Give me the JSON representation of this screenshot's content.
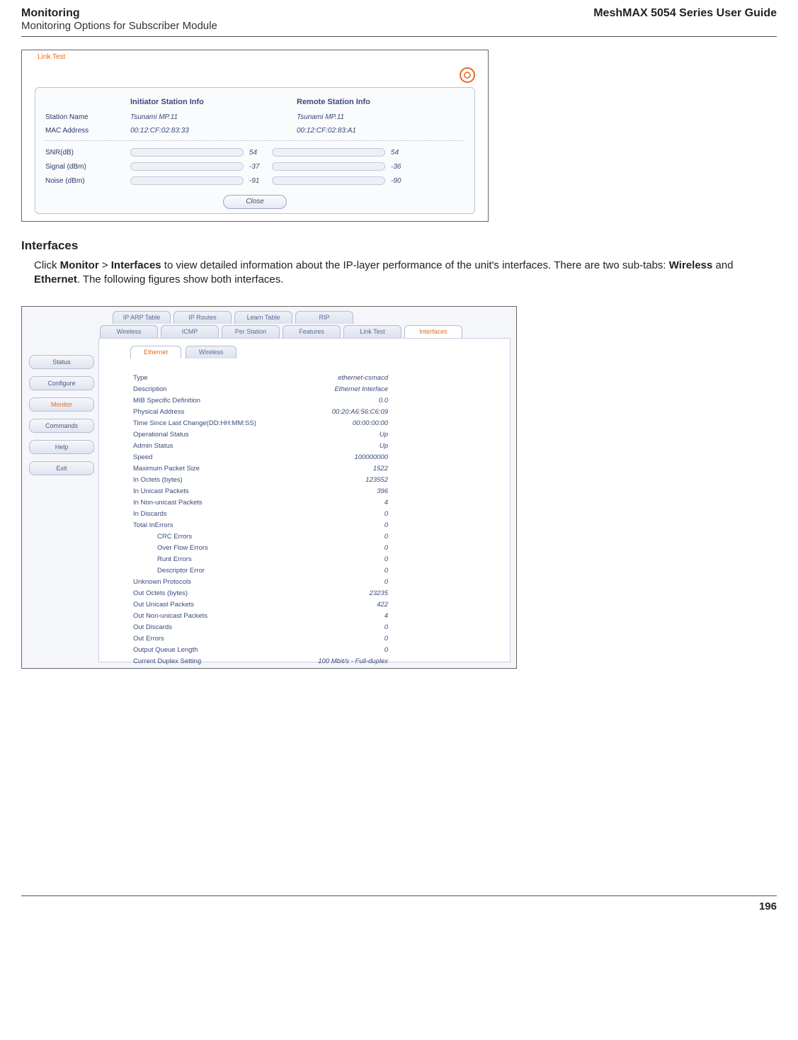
{
  "header": {
    "left_title": "Monitoring",
    "left_sub": "Monitoring Options for Subscriber Module",
    "right": "MeshMAX 5054 Series User Guide"
  },
  "fig1": {
    "title": "Link Test",
    "col_initiator": "Initiator Station Info",
    "col_remote": "Remote Station Info",
    "row_station_label": "Station Name",
    "row_station_init": "Tsunami MP.11",
    "row_station_remote": "Tsunami MP.11",
    "row_mac_label": "MAC Address",
    "row_mac_init": "00:12:CF:02:83:33",
    "row_mac_remote": "00:12:CF:02:83:A1",
    "row_snr_label": "SNR(dB)",
    "row_snr_init": "54",
    "row_snr_remote": "54",
    "row_sig_label": "Signal (dBm)",
    "row_sig_init": "-37",
    "row_sig_remote": "-36",
    "row_noise_label": "Noise (dBm)",
    "row_noise_init": "-91",
    "row_noise_remote": "-90",
    "close": "Close"
  },
  "section_h": "Interfaces",
  "body_text_pre": "Click ",
  "body_text_monitor": "Monitor",
  "body_text_gt": " > ",
  "body_text_interfaces": "Interfaces",
  "body_text_mid": " to view detailed information about the IP-layer performance of the unit's interfaces. There are two sub-tabs: ",
  "body_text_wireless": "Wireless",
  "body_text_and": " and ",
  "body_text_eth": "Ethernet",
  "body_text_end": ". The following figures show both interfaces.",
  "fig2": {
    "nav": [
      "Status",
      "Configure",
      "Monitor",
      "Commands",
      "Help",
      "Exit"
    ],
    "tabs_top": [
      "IP ARP Table",
      "IP Routes",
      "Learn Table",
      "RIP"
    ],
    "tabs_mid": [
      "Wireless",
      "ICMP",
      "Per Station",
      "Features",
      "Link Test",
      "Interfaces"
    ],
    "subtabs": [
      "Ethernet",
      "Wireless"
    ],
    "rows": [
      {
        "k": "Type",
        "v": "ethernet-csmacd"
      },
      {
        "k": "Description",
        "v": "Ethernet Interface"
      },
      {
        "k": "MIB Specific Definition",
        "v": "0.0"
      },
      {
        "k": "Physical Address",
        "v": "00:20:A6:56:C6:09"
      },
      {
        "k": "Time Since Last Change(DD:HH:MM:SS)",
        "v": "00:00:00:00"
      },
      {
        "k": "Operational Status",
        "v": "Up"
      },
      {
        "k": "Admin Status",
        "v": "Up"
      },
      {
        "k": "Speed",
        "v": "100000000"
      },
      {
        "k": "Maximum Packet Size",
        "v": "1522"
      },
      {
        "k": "In Octets (bytes)",
        "v": "123552"
      },
      {
        "k": "In Unicast Packets",
        "v": "396"
      },
      {
        "k": "In Non-unicast Packets",
        "v": "4"
      },
      {
        "k": "In Discards",
        "v": "0"
      },
      {
        "k": "Total InErrors",
        "v": "0"
      },
      {
        "k": "CRC Errors",
        "v": "0",
        "indent": true
      },
      {
        "k": "Over Flow Errors",
        "v": "0",
        "indent": true
      },
      {
        "k": "Runt Errors",
        "v": "0",
        "indent": true
      },
      {
        "k": "Descriptor Error",
        "v": "0",
        "indent": true
      },
      {
        "k": "Unknown Protocols",
        "v": "0"
      },
      {
        "k": "Out Octets (bytes)",
        "v": "23235"
      },
      {
        "k": "Out Unicast Packets",
        "v": "422"
      },
      {
        "k": "Out Non-unicast Packets",
        "v": "4"
      },
      {
        "k": "Out Discards",
        "v": "0"
      },
      {
        "k": "Out Errors",
        "v": "0"
      },
      {
        "k": "Output Queue Length",
        "v": "0"
      },
      {
        "k": "Current Duplex Setting",
        "v": "100 Mbit/s - Full-duplex"
      }
    ]
  },
  "footer_page": "196"
}
